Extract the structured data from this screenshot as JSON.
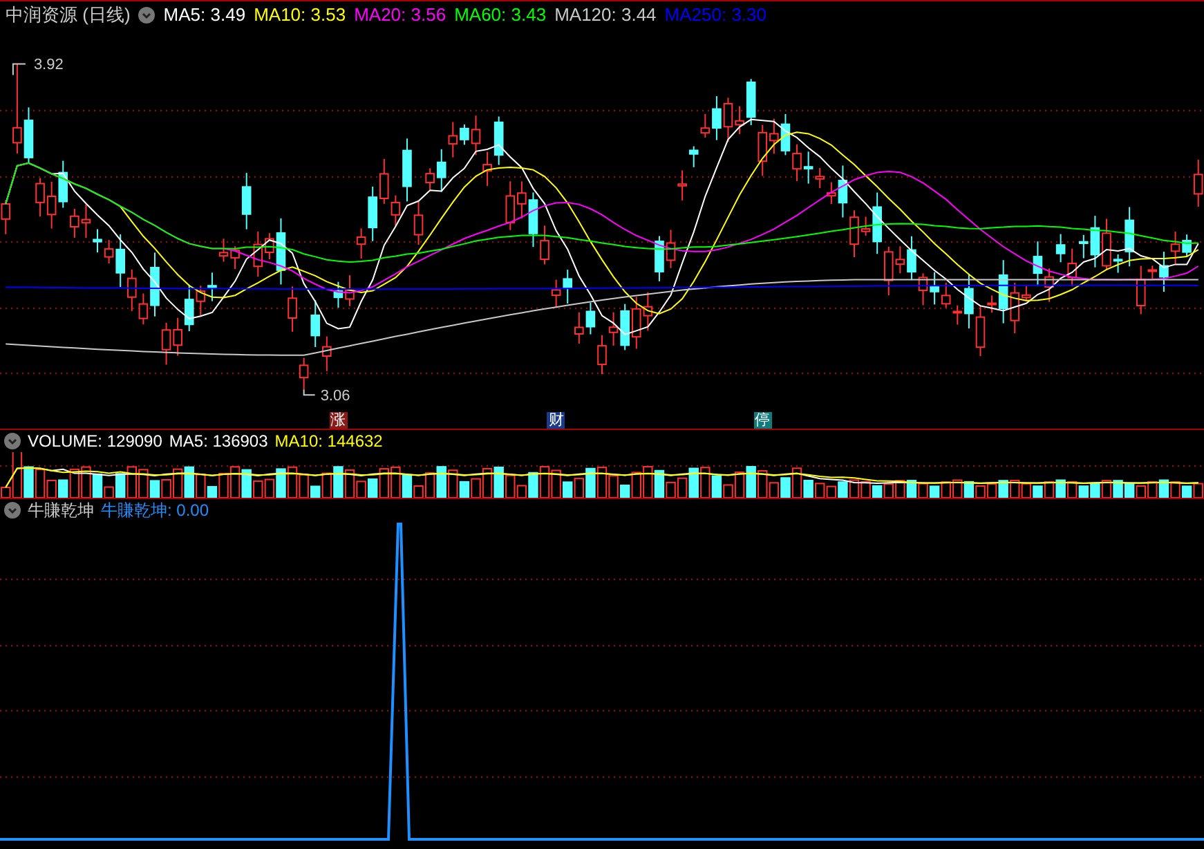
{
  "stock": {
    "name": "中润资源",
    "period": "(日线)"
  },
  "price_ma": [
    {
      "label": "MA5: 3.49",
      "color": "#ffffff"
    },
    {
      "label": "MA10: 3.53",
      "color": "#ffff00"
    },
    {
      "label": "MA20: 3.56",
      "color": "#ff00ff"
    },
    {
      "label": "MA60: 3.43",
      "color": "#00ff00"
    },
    {
      "label": "MA120: 3.44",
      "color": "#c8c8c8"
    },
    {
      "label": "MA250: 3.30",
      "color": "#0000ff"
    }
  ],
  "price_high": "3.92",
  "price_low": "3.06",
  "event_markers": [
    {
      "label": "涨",
      "color": "#8b1a1a"
    },
    {
      "label": "财",
      "color": "#1a3a8a"
    },
    {
      "label": "停",
      "color": "#117a7a"
    }
  ],
  "volume": [
    {
      "label": "VOLUME: 129090",
      "color": "#ffffff"
    },
    {
      "label": "MA5: 136903",
      "color": "#ffffff"
    },
    {
      "label": "MA10: 144632",
      "color": "#ffff00"
    }
  ],
  "indicator": {
    "name": "牛賺乾坤",
    "items": [
      {
        "label": "牛賺乾坤: 0.00",
        "color": "#1e90ff"
      }
    ]
  }
}
